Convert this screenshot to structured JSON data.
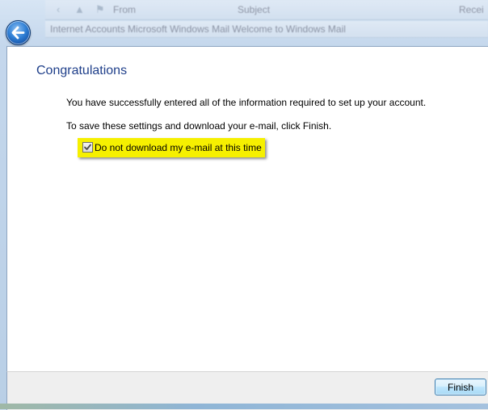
{
  "background_window": {
    "toolbar_items": [
      "From",
      "Subject",
      "Recei"
    ],
    "row_text": "Internet Accounts   Microsoft Windows Mail   Welcome to Windows Mail"
  },
  "back_button_label": "",
  "wizard": {
    "title": "Congratulations",
    "message_1": "You have successfully entered all of the information required to set up your account.",
    "message_2": "To save these settings and download your e-mail, click Finish.",
    "checkbox": {
      "label": "Do not download my e-mail at this time",
      "checked": true
    },
    "highlight_color": "#f6f000"
  },
  "footer": {
    "finish_label": "Finish"
  },
  "colors": {
    "title": "#1f3f8a",
    "back_button": "#2f7fd5",
    "finish_border": "#3c7fb1"
  }
}
